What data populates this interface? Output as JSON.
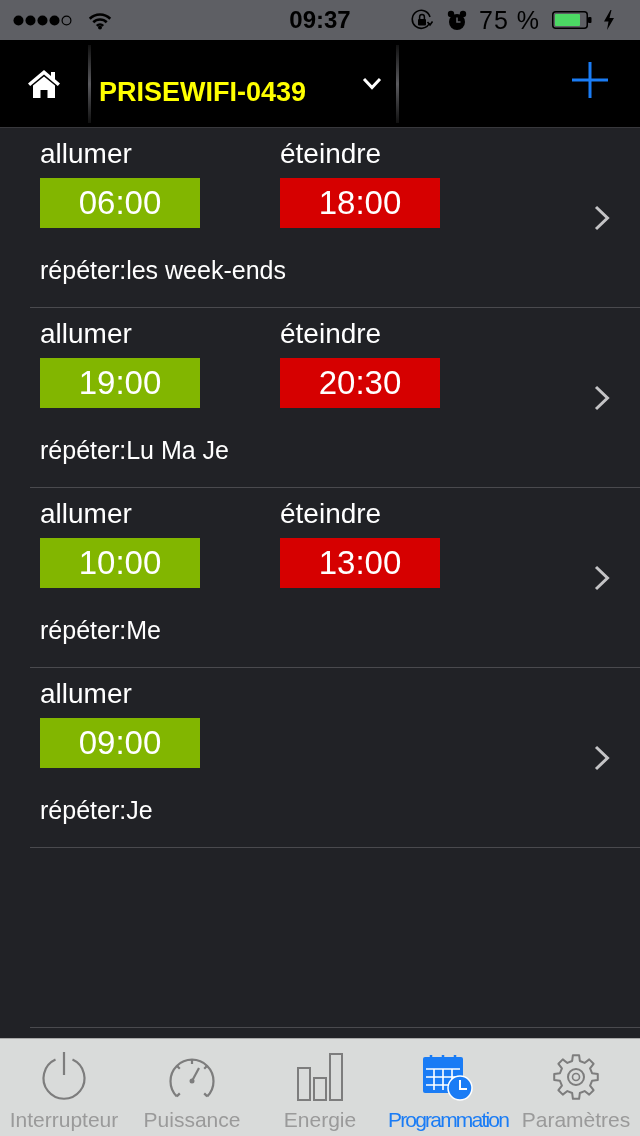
{
  "status_bar": {
    "time": "09:37",
    "battery": "75 %"
  },
  "nav_bar": {
    "device_name": "PRISEWIFI-0439"
  },
  "schedules": [
    {
      "on": {
        "label": "allumer",
        "time": "06:00"
      },
      "off": {
        "label": "éteindre",
        "time": "18:00"
      },
      "repeat": "répéter:les week-ends"
    },
    {
      "on": {
        "label": "allumer",
        "time": "19:00"
      },
      "off": {
        "label": "éteindre",
        "time": "20:30"
      },
      "repeat": "répéter:Lu Ma Je"
    },
    {
      "on": {
        "label": "allumer",
        "time": "10:00"
      },
      "off": {
        "label": "éteindre",
        "time": "13:00"
      },
      "repeat": "répéter:Me"
    },
    {
      "on": {
        "label": "allumer",
        "time": "09:00"
      },
      "repeat": "répéter:Je"
    }
  ],
  "tab_bar": [
    {
      "label": "Interrupteur",
      "selected": false
    },
    {
      "label": "Puissance",
      "selected": false
    },
    {
      "label": "Energie",
      "selected": false
    },
    {
      "label": "Programmation",
      "selected": true
    },
    {
      "label": "Paramètres",
      "selected": false
    }
  ]
}
